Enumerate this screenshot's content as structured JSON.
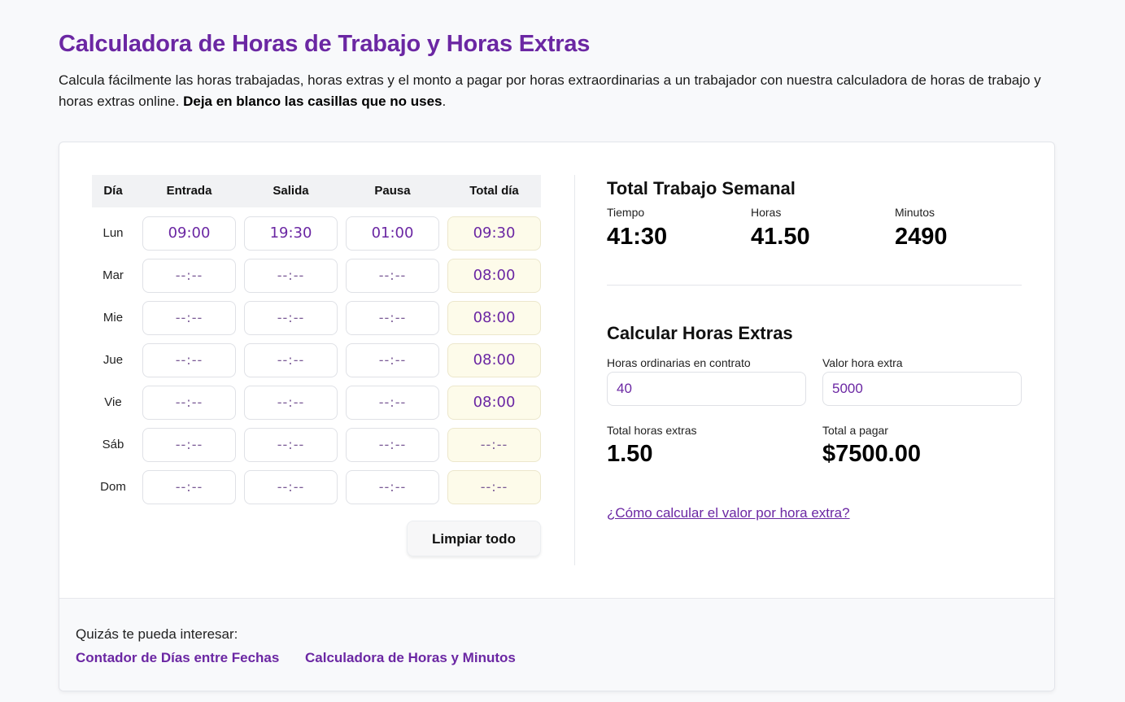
{
  "header": {
    "title": "Calculadora de Horas de Trabajo y Horas Extras",
    "intro": "Calcula fácilmente las horas trabajadas, horas extras y el monto a pagar por horas extraordinarias a un trabajador con nuestra calculadora de horas de trabajo y horas extras online. ",
    "intro_bold": "Deja en blanco las casillas que no uses",
    "intro_end": "."
  },
  "table": {
    "headers": {
      "day": "Día",
      "in": "Entrada",
      "out": "Salida",
      "pause": "Pausa",
      "total": "Total día"
    },
    "rows": [
      {
        "day": "Lun",
        "in": "09:00",
        "out": "19:30",
        "pause": "01:00",
        "total": "09:30"
      },
      {
        "day": "Mar",
        "in": "--:--",
        "out": "--:--",
        "pause": "--:--",
        "total": "08:00"
      },
      {
        "day": "Mie",
        "in": "--:--",
        "out": "--:--",
        "pause": "--:--",
        "total": "08:00"
      },
      {
        "day": "Jue",
        "in": "--:--",
        "out": "--:--",
        "pause": "--:--",
        "total": "08:00"
      },
      {
        "day": "Vie",
        "in": "--:--",
        "out": "--:--",
        "pause": "--:--",
        "total": "08:00"
      },
      {
        "day": "Sáb",
        "in": "--:--",
        "out": "--:--",
        "pause": "--:--",
        "total": "--:--"
      },
      {
        "day": "Dom",
        "in": "--:--",
        "out": "--:--",
        "pause": "--:--",
        "total": "--:--"
      }
    ],
    "clear_label": "Limpiar todo"
  },
  "weekly": {
    "title": "Total Trabajo Semanal",
    "time_label": "Tiempo",
    "time_value": "41:30",
    "hours_label": "Horas",
    "hours_value": "41.50",
    "minutes_label": "Minutos",
    "minutes_value": "2490"
  },
  "overtime": {
    "title": "Calcular Horas Extras",
    "contract_label": "Horas ordinarias en contrato",
    "contract_value": "40",
    "rate_label": "Valor hora extra",
    "rate_value": "5000",
    "total_extra_label": "Total horas extras",
    "total_extra_value": "1.50",
    "total_pay_label": "Total a pagar",
    "total_pay_value": "$7500.00",
    "howto_link": "¿Cómo calcular el valor por hora extra?"
  },
  "footer": {
    "maybe_label": "Quizás te pueda interesar:",
    "links": [
      "Contador de Días entre Fechas",
      "Calculadora de Horas y Minutos"
    ]
  },
  "colors": {
    "accent": "#6b27a3",
    "total_cell_bg": "#fdfbea"
  }
}
